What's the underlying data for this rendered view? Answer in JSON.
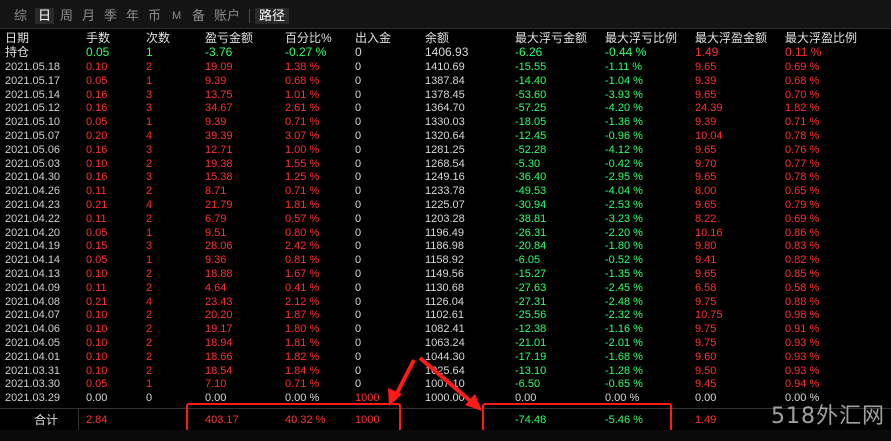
{
  "toolbar": {
    "tabs": [
      "综",
      "日",
      "周",
      "月",
      "季",
      "年",
      "币",
      "M",
      "备",
      "账户",
      "路径"
    ],
    "active": "日"
  },
  "headers": [
    "日期",
    "手数",
    "次数",
    "盈亏金额",
    "百分比%",
    "出入金",
    "余额",
    "最大浮亏金额",
    "最大浮亏比例",
    "最大浮盈金额",
    "最大浮盈比例"
  ],
  "holding": {
    "date": "持仓",
    "lots": "0.05",
    "count": "1",
    "pnl": "-3.76",
    "pct": "-0.27 %",
    "io": "0",
    "balance": "1406.93",
    "max_float_loss": "-6.26",
    "max_float_loss_pct": "-0.44 %",
    "max_float_profit": "1.49",
    "max_float_profit_pct": "0.11 %"
  },
  "rows": [
    {
      "date": "2021.05.18",
      "lots": "0.10",
      "count": "2",
      "pnl": "19.09",
      "pct": "1.38 %",
      "io": "0",
      "balance": "1410.69",
      "mfl": "-15.55",
      "mflp": "-1.11 %",
      "mfp": "9.65",
      "mfpp": "0.69 %"
    },
    {
      "date": "2021.05.17",
      "lots": "0.05",
      "count": "1",
      "pnl": "9.39",
      "pct": "0.68 %",
      "io": "0",
      "balance": "1387.84",
      "mfl": "-14.40",
      "mflp": "-1.04 %",
      "mfp": "9.39",
      "mfpp": "0.68 %"
    },
    {
      "date": "2021.05.14",
      "lots": "0.16",
      "count": "3",
      "pnl": "13.75",
      "pct": "1.01 %",
      "io": "0",
      "balance": "1378.45",
      "mfl": "-53.60",
      "mflp": "-3.93 %",
      "mfp": "9.65",
      "mfpp": "0.70 %"
    },
    {
      "date": "2021.05.12",
      "lots": "0.16",
      "count": "3",
      "pnl": "34.67",
      "pct": "2.61 %",
      "io": "0",
      "balance": "1364.70",
      "mfl": "-57.25",
      "mflp": "-4.20 %",
      "mfp": "24.39",
      "mfpp": "1.82 %"
    },
    {
      "date": "2021.05.10",
      "lots": "0.05",
      "count": "1",
      "pnl": "9.39",
      "pct": "0.71 %",
      "io": "0",
      "balance": "1330.03",
      "mfl": "-18.05",
      "mflp": "-1.36 %",
      "mfp": "9.39",
      "mfpp": "0.71 %"
    },
    {
      "date": "2021.05.07",
      "lots": "0.20",
      "count": "4",
      "pnl": "39.39",
      "pct": "3.07 %",
      "io": "0",
      "balance": "1320.64",
      "mfl": "-12.45",
      "mflp": "-0.96 %",
      "mfp": "10.04",
      "mfpp": "0.78 %"
    },
    {
      "date": "2021.05.06",
      "lots": "0.16",
      "count": "3",
      "pnl": "12.71",
      "pct": "1.00 %",
      "io": "0",
      "balance": "1281.25",
      "mfl": "-52.28",
      "mflp": "-4.12 %",
      "mfp": "9.65",
      "mfpp": "0.76 %"
    },
    {
      "date": "2021.05.03",
      "lots": "0.10",
      "count": "2",
      "pnl": "19.38",
      "pct": "1.55 %",
      "io": "0",
      "balance": "1268.54",
      "mfl": "-5.30",
      "mflp": "-0.42 %",
      "mfp": "9.70",
      "mfpp": "0.77 %"
    },
    {
      "date": "2021.04.30",
      "lots": "0.16",
      "count": "3",
      "pnl": "15.38",
      "pct": "1.25 %",
      "io": "0",
      "balance": "1249.16",
      "mfl": "-36.40",
      "mflp": "-2.95 %",
      "mfp": "9.65",
      "mfpp": "0.78 %"
    },
    {
      "date": "2021.04.26",
      "lots": "0.11",
      "count": "2",
      "pnl": "8.71",
      "pct": "0.71 %",
      "io": "0",
      "balance": "1233.78",
      "mfl": "-49.53",
      "mflp": "-4.04 %",
      "mfp": "8.00",
      "mfpp": "0.65 %"
    },
    {
      "date": "2021.04.23",
      "lots": "0.21",
      "count": "4",
      "pnl": "21.79",
      "pct": "1.81 %",
      "io": "0",
      "balance": "1225.07",
      "mfl": "-30.94",
      "mflp": "-2.53 %",
      "mfp": "9.65",
      "mfpp": "0.79 %"
    },
    {
      "date": "2021.04.22",
      "lots": "0.11",
      "count": "2",
      "pnl": "6.79",
      "pct": "0.57 %",
      "io": "0",
      "balance": "1203.28",
      "mfl": "-38.81",
      "mflp": "-3.23 %",
      "mfp": "8.22",
      "mfpp": "0.69 %"
    },
    {
      "date": "2021.04.20",
      "lots": "0.05",
      "count": "1",
      "pnl": "9.51",
      "pct": "0.80 %",
      "io": "0",
      "balance": "1196.49",
      "mfl": "-26.31",
      "mflp": "-2.20 %",
      "mfp": "10.16",
      "mfpp": "0.86 %"
    },
    {
      "date": "2021.04.19",
      "lots": "0.15",
      "count": "3",
      "pnl": "28.06",
      "pct": "2.42 %",
      "io": "0",
      "balance": "1186.98",
      "mfl": "-20.84",
      "mflp": "-1.80 %",
      "mfp": "9.80",
      "mfpp": "0.83 %"
    },
    {
      "date": "2021.04.14",
      "lots": "0.05",
      "count": "1",
      "pnl": "9.36",
      "pct": "0.81 %",
      "io": "0",
      "balance": "1158.92",
      "mfl": "-6.05",
      "mflp": "-0.52 %",
      "mfp": "9.41",
      "mfpp": "0.82 %"
    },
    {
      "date": "2021.04.13",
      "lots": "0.10",
      "count": "2",
      "pnl": "18.88",
      "pct": "1.67 %",
      "io": "0",
      "balance": "1149.56",
      "mfl": "-15.27",
      "mflp": "-1.35 %",
      "mfp": "9.65",
      "mfpp": "0.85 %"
    },
    {
      "date": "2021.04.09",
      "lots": "0.11",
      "count": "2",
      "pnl": "4.64",
      "pct": "0.41 %",
      "io": "0",
      "balance": "1130.68",
      "mfl": "-27.63",
      "mflp": "-2.45 %",
      "mfp": "6.58",
      "mfpp": "0.58 %"
    },
    {
      "date": "2021.04.08",
      "lots": "0.21",
      "count": "4",
      "pnl": "23.43",
      "pct": "2.12 %",
      "io": "0",
      "balance": "1126.04",
      "mfl": "-27.31",
      "mflp": "-2.48 %",
      "mfp": "9.75",
      "mfpp": "0.88 %"
    },
    {
      "date": "2021.04.07",
      "lots": "0.10",
      "count": "2",
      "pnl": "20.20",
      "pct": "1.87 %",
      "io": "0",
      "balance": "1102.61",
      "mfl": "-25.56",
      "mflp": "-2.32 %",
      "mfp": "10.75",
      "mfpp": "0.98 %"
    },
    {
      "date": "2021.04.06",
      "lots": "0.10",
      "count": "2",
      "pnl": "19.17",
      "pct": "1.80 %",
      "io": "0",
      "balance": "1082.41",
      "mfl": "-12.38",
      "mflp": "-1.16 %",
      "mfp": "9.75",
      "mfpp": "0.91 %"
    },
    {
      "date": "2021.04.05",
      "lots": "0.10",
      "count": "2",
      "pnl": "18.94",
      "pct": "1.81 %",
      "io": "0",
      "balance": "1063.24",
      "mfl": "-21.01",
      "mflp": "-2.01 %",
      "mfp": "9.75",
      "mfpp": "0.93 %"
    },
    {
      "date": "2021.04.01",
      "lots": "0.10",
      "count": "2",
      "pnl": "18.66",
      "pct": "1.82 %",
      "io": "0",
      "balance": "1044.30",
      "mfl": "-17.19",
      "mflp": "-1.68 %",
      "mfp": "9.60",
      "mfpp": "0.93 %"
    },
    {
      "date": "2021.03.31",
      "lots": "0.10",
      "count": "2",
      "pnl": "18.54",
      "pct": "1.84 %",
      "io": "0",
      "balance": "1025.64",
      "mfl": "-13.10",
      "mflp": "-1.28 %",
      "mfp": "9.50",
      "mfpp": "0.93 %"
    },
    {
      "date": "2021.03.30",
      "lots": "0.05",
      "count": "1",
      "pnl": "7.10",
      "pct": "0.71 %",
      "io": "0",
      "balance": "1007.10",
      "mfl": "-6.50",
      "mflp": "-0.65 %",
      "mfp": "9.45",
      "mfpp": "0.94 %"
    },
    {
      "date": "2021.03.29",
      "lots": "0.00",
      "count": "0",
      "pnl": "0.00",
      "pct": "0.00 %",
      "io": "1000",
      "balance": "1000.00",
      "mfl": "0.00",
      "mflp": "0.00 %",
      "mfp": "0.00",
      "mfpp": "0.00 %"
    }
  ],
  "totals": {
    "label": "合计",
    "lots": "2.84",
    "pnl": "403.17",
    "pct": "40.32 %",
    "io": "1000",
    "max_float_loss": "-74.48",
    "max_float_loss_pct": "-5.46 %",
    "max_float_profit": "1.49"
  },
  "watermark": "518外汇网",
  "colors": {
    "profit": "#ff3030",
    "loss": "#2dff6a",
    "annotation": "#ff1a1a",
    "background": "#000000"
  }
}
